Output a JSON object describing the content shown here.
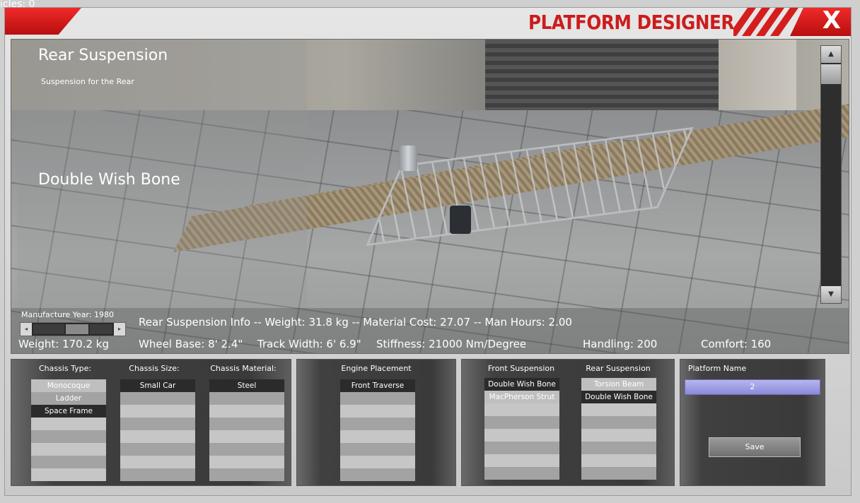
{
  "debug": {
    "line1": "",
    "line2": "icles: 0"
  },
  "title": "PLATFORM DESIGNER",
  "close_label": "X",
  "viewport": {
    "part_category": "Rear Suspension",
    "part_description": "Suspension for the Rear",
    "part_name": "Double Wish Bone",
    "manufacture_label": "Manufacture Year: 1980",
    "manufacture_year_fraction": 0.45,
    "info": "Rear Suspension Info  -- Weight: 31.8 kg -- Material Cost: 27.07 -- Man Hours: 2.00",
    "stats": {
      "weight": "Weight: 170.2 kg",
      "wheel_base": "Wheel Base: 8' 2.4\"",
      "track_width": "Track Width: 6' 6.9\"",
      "stiffness": "Stiffness: 21000 Nm/Degree",
      "handling": "Handling: 200",
      "comfort": "Comfort: 160"
    },
    "scroll_up": "▲",
    "scroll_down": "▼"
  },
  "chassis": {
    "type_header": "Chassis Type:",
    "type_options": [
      "Monocoque",
      "Ladder",
      "Space Frame"
    ],
    "size_header": "Chassis Size:",
    "size_options": [
      "Small Car"
    ],
    "material_header": "Chassis Material:",
    "material_options": [
      "Steel"
    ]
  },
  "engine": {
    "header": "Engine Placement",
    "options": [
      "Front Traverse"
    ]
  },
  "suspension": {
    "front_header": "Front Suspension",
    "front_options": [
      "Double Wish Bone",
      "MacPherson Strut"
    ],
    "rear_header": "Rear Suspension",
    "rear_options": [
      "Torsion  Beam",
      "Double Wish Bone"
    ]
  },
  "platform": {
    "name_header": "Platform Name",
    "name_value": "2",
    "save_label": "Save"
  },
  "colors": {
    "accent_red": "#d41e1e",
    "selected_row": "#2b2b2b",
    "name_field": "#9a99e0"
  }
}
